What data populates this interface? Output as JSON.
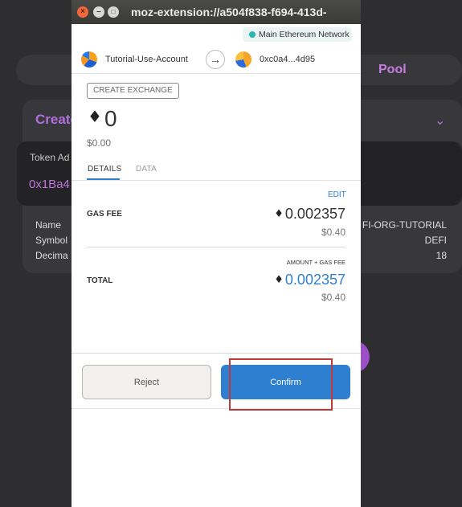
{
  "background": {
    "pool_tab": "Pool",
    "create_heading": "Create",
    "chevron_icon": "chevron-down-icon",
    "token_label": "Token Ad",
    "token_address": "0x1Ba4",
    "rows": [
      {
        "label": "Name",
        "value": "FI-ORG-TUTORIAL"
      },
      {
        "label": "Symbol",
        "value": "DEFI"
      },
      {
        "label": "Decima",
        "value": "18"
      }
    ],
    "accent": "#b06fdb"
  },
  "window": {
    "title": "moz-extension://a504f838-f694-413d-",
    "buttons": {
      "close": "×",
      "minimize": "–",
      "maximize": "□"
    }
  },
  "network": {
    "label": "Main Ethereum Network",
    "dot_color": "#29b6af"
  },
  "accounts": {
    "from_name": "Tutorial-Use-Account",
    "arrow_icon": "arrow-right-icon",
    "to_address": "0xc0a4...4d95"
  },
  "transaction": {
    "method": "CREATE EXCHANGE",
    "eth_symbol": "♦",
    "amount": "0",
    "amount_fiat": "$0.00"
  },
  "tabs": {
    "details": "DETAILS",
    "data": "DATA",
    "active": "details"
  },
  "details": {
    "edit": "EDIT",
    "gas_fee_label": "GAS FEE",
    "gas_fee_value": "0.002357",
    "gas_fee_fiat": "$0.40",
    "amount_gas_caption": "AMOUNT + GAS FEE",
    "total_label": "TOTAL",
    "total_value": "0.002357",
    "total_fiat": "$0.40"
  },
  "actions": {
    "reject": "Reject",
    "confirm": "Confirm"
  },
  "colors": {
    "primary": "#2f7fd1",
    "highlight": "#c0393b"
  }
}
